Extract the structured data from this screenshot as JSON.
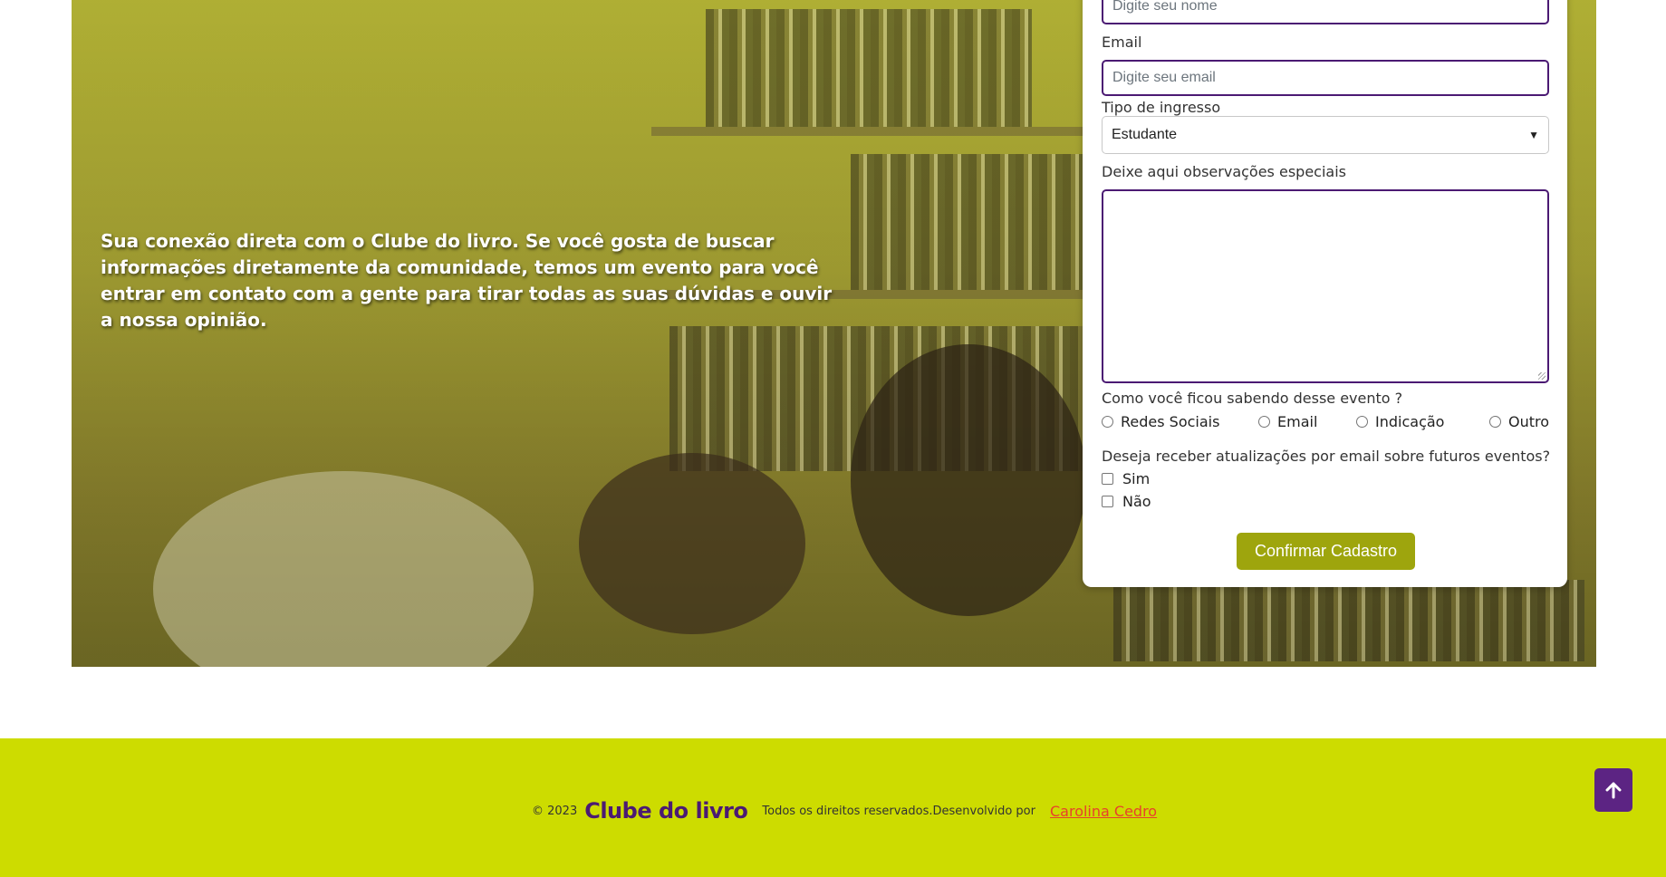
{
  "hero": {
    "text": "Sua conexão direta com o Clube do livro. Se você gosta de buscar informações diretamente da comunidade, temos um evento para você entrar em contato com a gente para tirar todas as suas dúvidas e ouvir a nossa opinião."
  },
  "form": {
    "name_placeholder": "Digite seu nome",
    "email_label": "Email",
    "email_placeholder": "Digite seu email",
    "ticket_label": "Tipo de ingresso",
    "ticket_selected": "Estudante",
    "notes_label": "Deixe aqui observações especiais",
    "source_question": "Como você ficou sabendo desse evento ?",
    "source_options": [
      "Redes Sociais",
      "Email",
      "Indicação",
      "Outro"
    ],
    "updates_question": "Deseja receber atualizações por email sobre futuros eventos?",
    "updates_options": [
      "Sim",
      "Não"
    ],
    "submit_label": "Confirmar Cadastro"
  },
  "footer": {
    "copyright": "© 2023",
    "brand": "Clube do livro",
    "rights": "Todos os direitos reservados.",
    "developed_by": "Desenvolvido por",
    "author": "Carolina Cedro"
  },
  "colors": {
    "accent_purple": "#4b1a73",
    "button_olive": "#9ea50d",
    "footer_lime": "#cddc00",
    "author_link": "#e8412b"
  },
  "icons": {
    "back_to_top": "arrow-up-icon"
  }
}
